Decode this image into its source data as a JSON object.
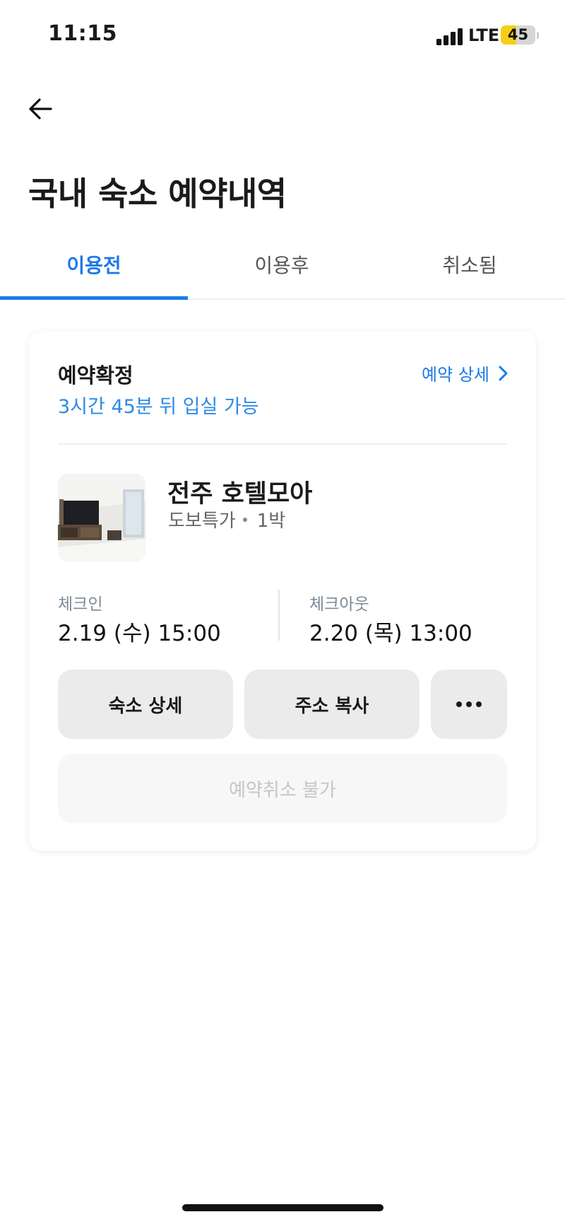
{
  "status_bar": {
    "time": "11:15",
    "network": "LTE",
    "battery_level": "45",
    "battery_fraction": 0.45,
    "battery_color": "#f6cd18"
  },
  "header": {
    "back_icon": "arrow-left-icon",
    "title": "국내 숙소 예약내역"
  },
  "tabs": [
    {
      "label": "이용전",
      "active": true
    },
    {
      "label": "이용후",
      "active": false
    },
    {
      "label": "취소됨",
      "active": false
    }
  ],
  "accent_color": "#1b7ae8",
  "reservation": {
    "status": "예약확정",
    "status_sub": "3시간 45분 뒤 입실 가능",
    "detail_link": "예약 상세",
    "hotel_name": "전주 호텔모아",
    "rate_type": "도보특가",
    "nights": "1박",
    "checkin_label": "체크인",
    "checkin_value": "2.19 (수) 15:00",
    "checkout_label": "체크아웃",
    "checkout_value": "2.20 (목) 13:00",
    "buttons": {
      "hotel_detail": "숙소 상세",
      "copy_address": "주소 복사",
      "more_icon": "more-horizontal-icon"
    },
    "cancel_label": "예약취소 불가"
  }
}
